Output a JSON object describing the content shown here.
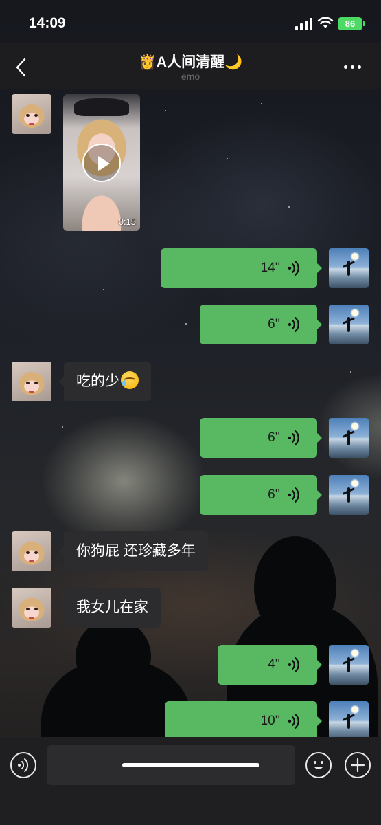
{
  "status_bar": {
    "time": "14:09",
    "battery": "86"
  },
  "nav": {
    "title": "👸A人间清醒🌙",
    "subtitle": "emo",
    "icons": {
      "back": "chevron-left-icon",
      "more": "more-dots-icon"
    }
  },
  "messages": [
    {
      "sender": "her",
      "type": "video",
      "duration": "0:15"
    },
    {
      "sender": "me",
      "type": "voice",
      "duration": "14''"
    },
    {
      "sender": "me",
      "type": "voice",
      "duration": "6''"
    },
    {
      "sender": "her",
      "type": "text",
      "text": "吃的少"
    },
    {
      "sender": "me",
      "type": "voice",
      "duration": "6''"
    },
    {
      "sender": "me",
      "type": "voice",
      "duration": "6''"
    },
    {
      "sender": "her",
      "type": "text",
      "text": "你狗屁 还珍藏多年"
    },
    {
      "sender": "her",
      "type": "text",
      "text": "我女儿在家"
    },
    {
      "sender": "me",
      "type": "voice",
      "duration": "4''"
    },
    {
      "sender": "me",
      "type": "voice",
      "duration": "10''"
    }
  ],
  "input_bar": {
    "placeholder": "",
    "icons": {
      "voice": "voice-toggle-icon",
      "emoji": "emoji-icon",
      "plus": "plus-icon"
    }
  },
  "colors": {
    "outgoing_bubble": "#59b963",
    "incoming_bubble": "#2c2c2e",
    "battery": "#4cd964"
  }
}
